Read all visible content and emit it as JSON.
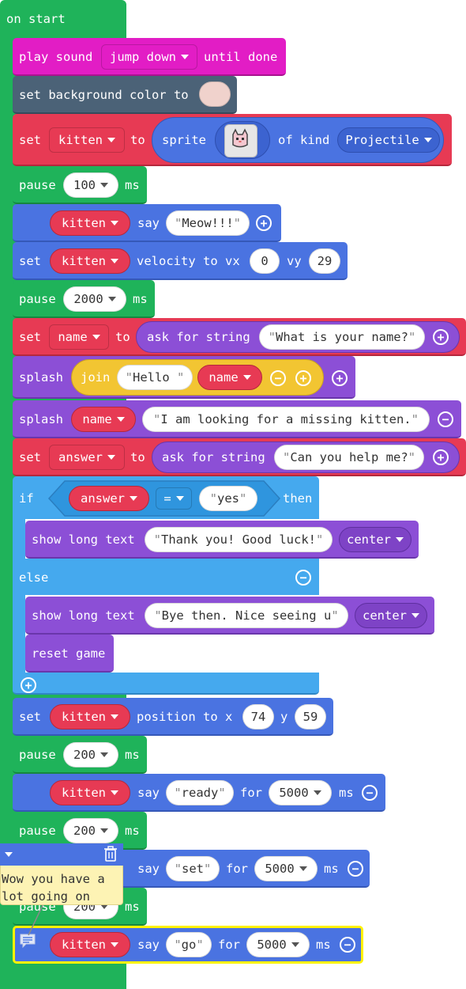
{
  "on_start": {
    "label": "on start"
  },
  "rows": {
    "play_sound": {
      "label": "play sound",
      "sound": "jump down",
      "until": "until done"
    },
    "set_bg": {
      "label": "set background color to",
      "color": "#f0d2cc"
    },
    "set_kitten_sprite": {
      "set": "set",
      "var": "kitten",
      "to": "to",
      "sprite": "sprite",
      "of_kind": "of kind",
      "kind": "Projectile"
    },
    "pause1": {
      "label": "pause",
      "value": "100",
      "unit": "ms"
    },
    "say1": {
      "var": "kitten",
      "say": "say",
      "text": "Meow!!!"
    },
    "velocity": {
      "set": "set",
      "var": "kitten",
      "label": "velocity to vx",
      "vx": "0",
      "vy_label": "vy",
      "vy": "29"
    },
    "pause2": {
      "label": "pause",
      "value": "2000",
      "unit": "ms"
    },
    "set_name": {
      "set": "set",
      "var": "name",
      "to": "to",
      "ask": "ask for string",
      "prompt": "What is your name?"
    },
    "splash1": {
      "label": "splash",
      "join": "join",
      "text": "Hello ",
      "var": "name"
    },
    "splash2": {
      "label": "splash",
      "var": "name",
      "text": "I am looking for a missing kitten."
    },
    "set_answer": {
      "set": "set",
      "var": "answer",
      "to": "to",
      "ask": "ask for string",
      "prompt": "Can you help me?"
    },
    "if_block": {
      "if": "if",
      "var": "answer",
      "op": "=",
      "value": "yes",
      "then": "then"
    },
    "show1": {
      "label": "show long text",
      "text": "Thank you! Good luck!",
      "align": "center"
    },
    "else": {
      "label": "else"
    },
    "show2": {
      "label": "show long text",
      "text": "Bye then. Nice seeing u",
      "align": "center"
    },
    "reset": {
      "label": "reset game"
    },
    "position": {
      "set": "set",
      "var": "kitten",
      "label": "position to x",
      "x": "74",
      "y_label": "y",
      "y": "59"
    },
    "pause3": {
      "label": "pause",
      "value": "200",
      "unit": "ms"
    },
    "say_ready": {
      "var": "kitten",
      "say": "say",
      "text": "ready",
      "for": "for",
      "ms_value": "5000",
      "unit": "ms"
    },
    "pause4": {
      "label": "pause",
      "value": "200",
      "unit": "ms"
    },
    "say_set": {
      "say": "say",
      "text": "set",
      "for": "for",
      "ms_value": "5000",
      "unit": "ms"
    },
    "pause5": {
      "label": "pause",
      "value": "200",
      "unit": "ms"
    },
    "say_go": {
      "var": "kitten",
      "say": "say",
      "text": "go",
      "for": "for",
      "ms_value": "5000",
      "unit": "ms"
    }
  },
  "comment": {
    "text_line1": "Wow you have a",
    "text_line2": "lot going on"
  }
}
